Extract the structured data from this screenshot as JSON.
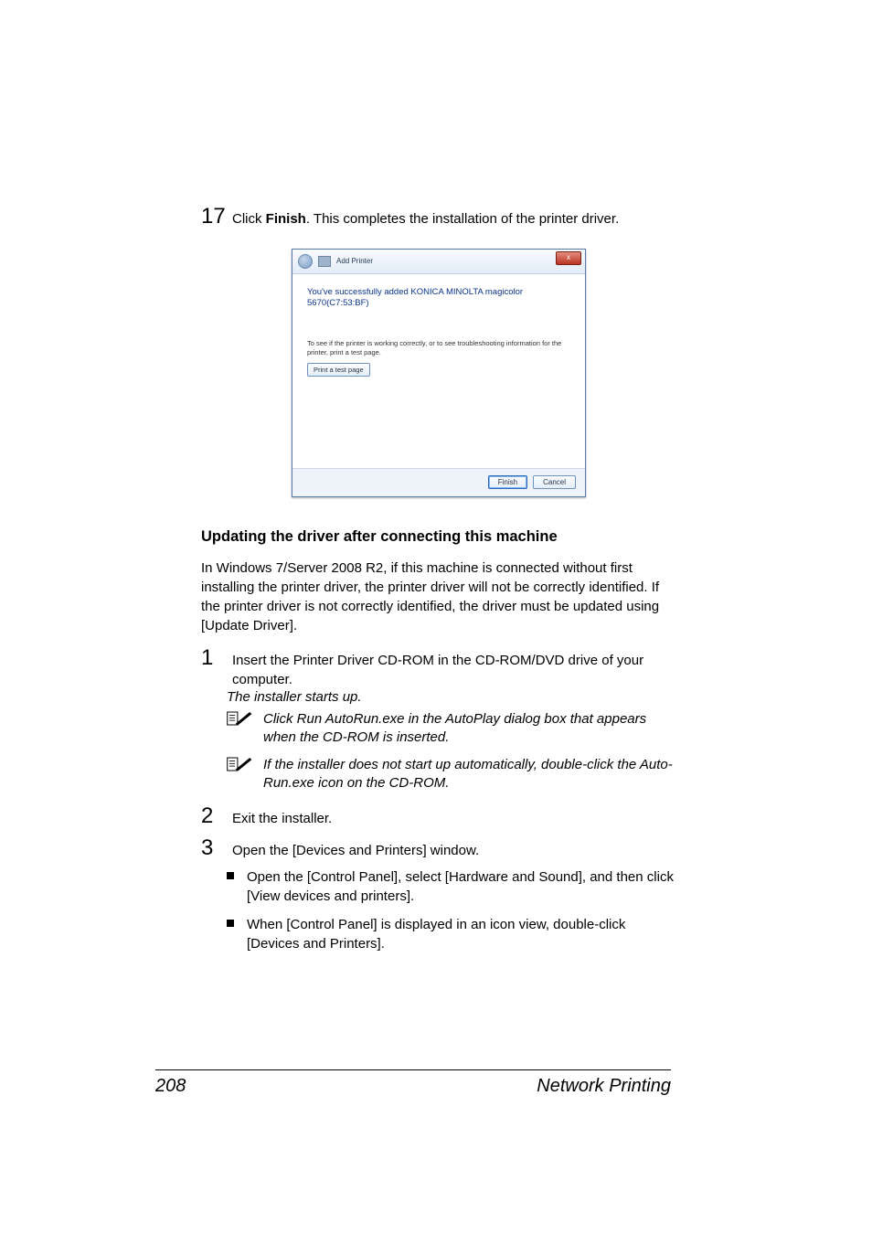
{
  "step17": {
    "num": "17",
    "prefix": "Click ",
    "bold": "Finish",
    "suffix": ". This completes the installation of the printer driver."
  },
  "screenshot": {
    "title": "Add Printer",
    "closeGlyph": "x",
    "success1": "You've successfully added KONICA MINOLTA magicolor",
    "success2": "5670(C7:53:BF)",
    "testInfo": "To see if the printer is working correctly, or to see troubleshooting information for the printer, print a test page.",
    "testBtn": "Print a test page",
    "finishBtn": "Finish",
    "cancelBtn": "Cancel"
  },
  "section": {
    "heading": "Updating the driver after connecting this machine",
    "intro": "In Windows 7/Server 2008 R2, if this machine is connected without first installing the printer driver, the printer driver will not be correctly identified. If the printer driver is not correctly identified, the driver must be updated using [Update Driver]."
  },
  "steps": {
    "s1": {
      "num": "1",
      "text": "Insert the Printer Driver CD-ROM in the CD-ROM/DVD drive of your computer."
    },
    "s1_starts": "The installer starts up.",
    "s1_note1": "Click Run AutoRun.exe in the AutoPlay dialog box that appears when the CD-ROM is inserted.",
    "s1_note2": "If the installer does not start up automatically, double-click the Auto-Run.exe icon on the CD-ROM.",
    "s2": {
      "num": "2",
      "text": "Exit the installer."
    },
    "s3": {
      "num": "3",
      "text": "Open the [Devices and Printers] window."
    },
    "s3_bullets": [
      "Open the [Control Panel], select [Hardware and Sound], and then click [View devices and printers].",
      "When [Control Panel] is displayed in an icon view, double-click [Devices and Printers]."
    ]
  },
  "footer": {
    "pageNum": "208",
    "section": "Network Printing"
  }
}
